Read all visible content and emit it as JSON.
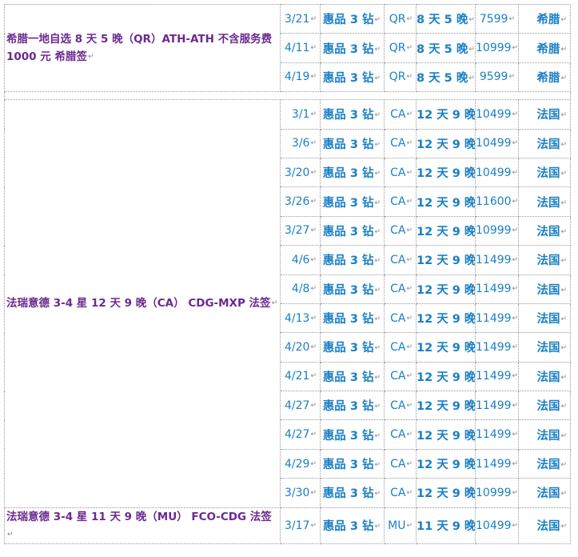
{
  "colors": {
    "name_text": "#6b2a8f",
    "cell_text": "#1a7fc4",
    "border": "#9a9a9a"
  },
  "return_mark": "↵",
  "groups": [
    {
      "name": "希腊一地自选 8 天 5 晚（QR）ATH-ATH 不含服务费 1000 元 希腊签",
      "rows": [
        {
          "date": "3/21",
          "product": "惠品 3 钻",
          "airline": "QR",
          "duration": "8 天 5 晚",
          "price": "7599",
          "visa": "希腊"
        },
        {
          "date": "4/11",
          "product": "惠品 3 钻",
          "airline": "QR",
          "duration": "8 天 5 晚",
          "price": "10999",
          "visa": "希腊"
        },
        {
          "date": "4/19",
          "product": "惠品 3 钻",
          "airline": "QR",
          "duration": "8 天 5 晚",
          "price": "9599",
          "visa": "希腊"
        }
      ]
    },
    {
      "name": "法瑞意德 3-4 星 12 天 9 晚（CA） CDG-MXP 法签",
      "rows": [
        {
          "date": "3/1",
          "product": "惠品 3 钻",
          "airline": "CA",
          "duration": "12 天 9 晚",
          "price": "10499",
          "visa": "法国"
        },
        {
          "date": "3/6",
          "product": "惠品 3 钻",
          "airline": "CA",
          "duration": "12 天 9 晚",
          "price": "10499",
          "visa": "法国"
        },
        {
          "date": "3/20",
          "product": "惠品 3 钻",
          "airline": "CA",
          "duration": "12 天 9 晚",
          "price": "10499",
          "visa": "法国"
        },
        {
          "date": "3/26",
          "product": "惠品 3 钻",
          "airline": "CA",
          "duration": "12 天 9 晚",
          "price": "11600",
          "visa": "法国"
        },
        {
          "date": "3/27",
          "product": "惠品 3 钻",
          "airline": "CA",
          "duration": "12 天 9 晚",
          "price": "10999",
          "visa": "法国"
        },
        {
          "date": "4/6",
          "product": "惠品 3 钻",
          "airline": "CA",
          "duration": "12 天 9 晚",
          "price": "11499",
          "visa": "法国"
        },
        {
          "date": "4/8",
          "product": "惠品 3 钻",
          "airline": "CA",
          "duration": "12 天 9 晚",
          "price": "11499",
          "visa": "法国"
        },
        {
          "date": "4/13",
          "product": "惠品 3 钻",
          "airline": "CA",
          "duration": "12 天 9 晚",
          "price": "11499",
          "visa": "法国"
        },
        {
          "date": "4/20",
          "product": "惠品 3 钻",
          "airline": "CA",
          "duration": "12 天 9 晚",
          "price": "11499",
          "visa": "法国"
        },
        {
          "date": "4/21",
          "product": "惠品 3 钻",
          "airline": "CA",
          "duration": "12 天 9 晚",
          "price": "11499",
          "visa": "法国"
        },
        {
          "date": "4/27",
          "product": "惠品 3 钻",
          "airline": "CA",
          "duration": "12 天 9 晚",
          "price": "11499",
          "visa": "法国"
        },
        {
          "date": "4/27",
          "product": "惠品 3 钻",
          "airline": "CA",
          "duration": "12 天 9 晚",
          "price": "11499",
          "visa": "法国"
        },
        {
          "date": "4/29",
          "product": "惠品 3 钻",
          "airline": "CA",
          "duration": "12 天 9 晚",
          "price": "11499",
          "visa": "法国"
        },
        {
          "date": "3/30",
          "product": "惠品 3 钻",
          "airline": "CA",
          "duration": "12 天 9 晚",
          "price": "10999",
          "visa": "法国"
        }
      ]
    },
    {
      "name": "法瑞意德 3-4 星 11 天 9 晚（MU） FCO-CDG 法签",
      "rows": [
        {
          "date": "3/17",
          "product": "惠品 3 钻",
          "airline": "MU",
          "duration": "11 天 9 晚",
          "price": "10499",
          "visa": "法国"
        }
      ]
    }
  ]
}
